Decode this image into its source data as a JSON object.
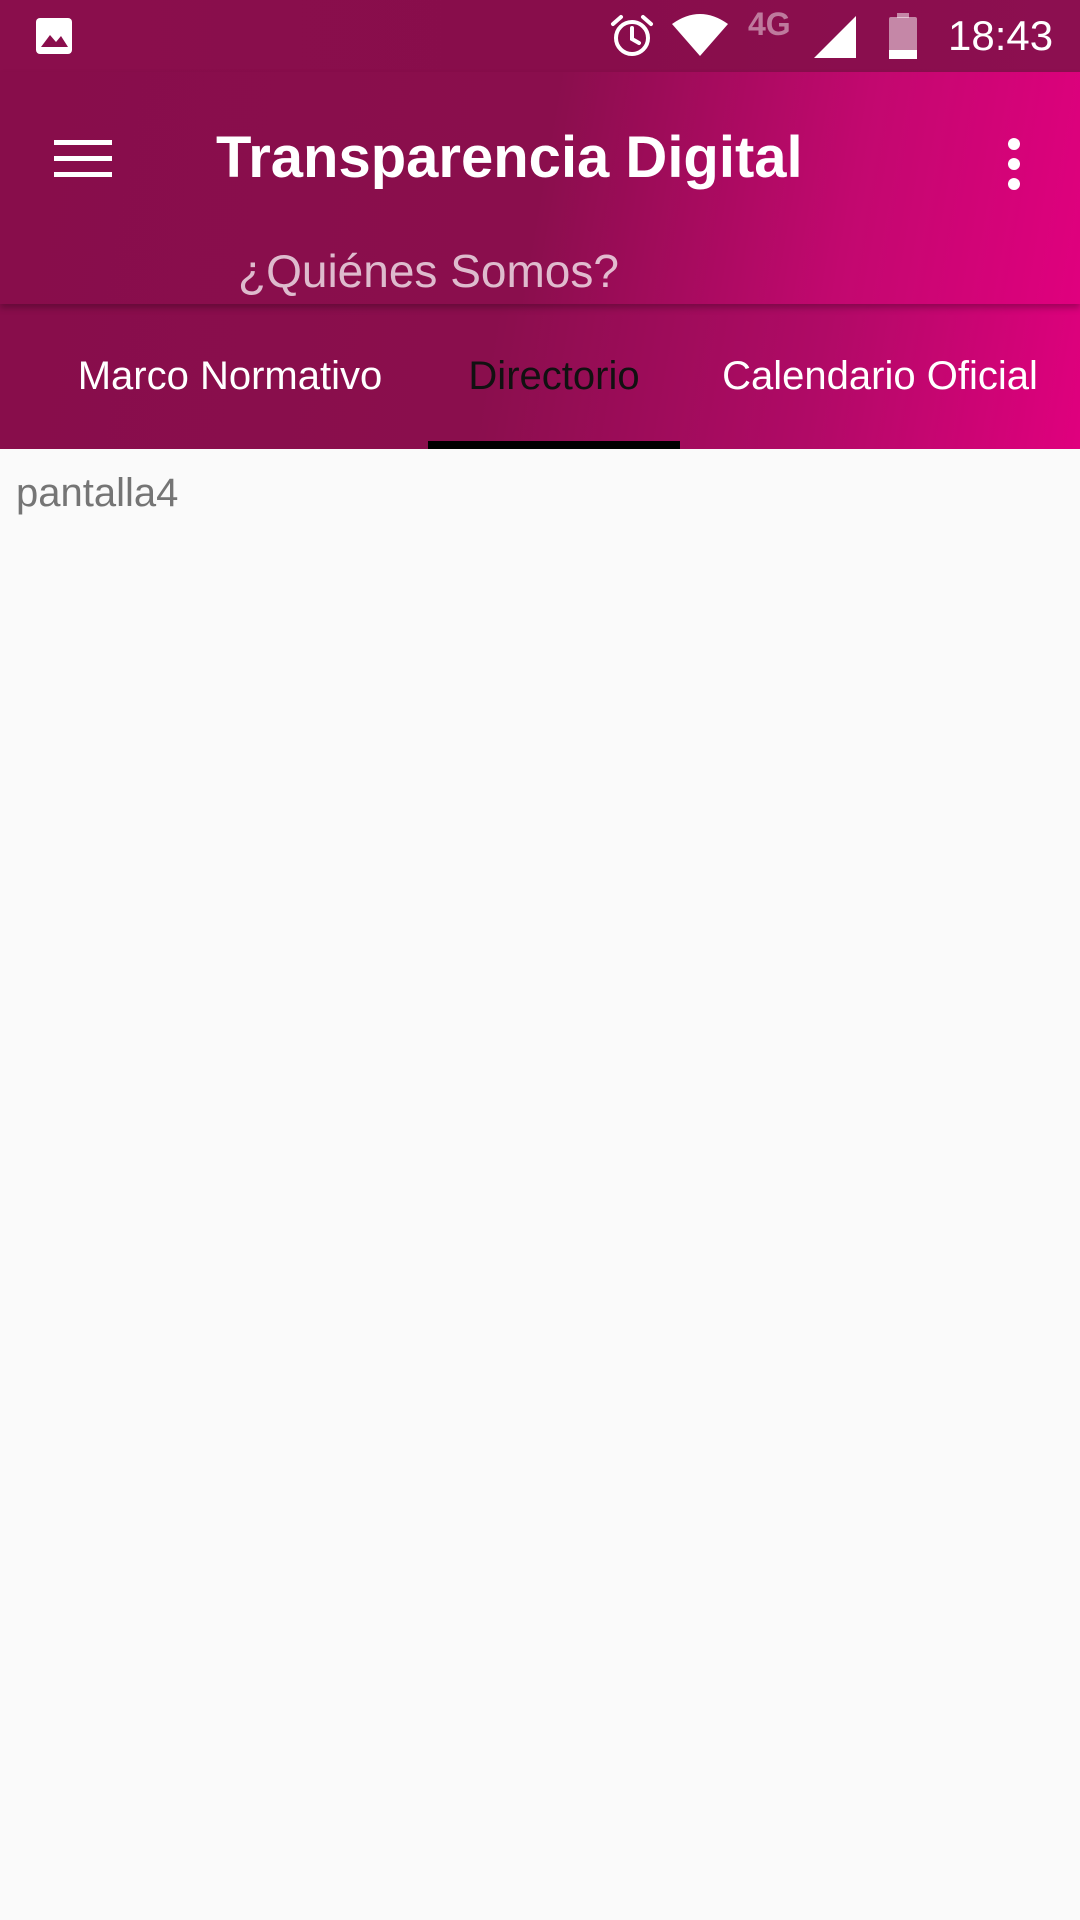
{
  "status_bar": {
    "notification_icon": "image-icon",
    "alarm_icon": "alarm-clock-icon",
    "wifi_icon": "wifi-icon",
    "network_type": "4G",
    "signal_icon": "cellular-signal-icon",
    "battery_icon": "battery-icon",
    "time": "18:43"
  },
  "app_bar": {
    "title": "Transparencia Digital",
    "subtitle": "¿Quiénes Somos?",
    "menu_icon": "hamburger-menu-icon",
    "overflow_icon": "more-vert-icon"
  },
  "tabs": [
    {
      "label": "Marco Normativo",
      "selected": false
    },
    {
      "label": "Directorio",
      "selected": true
    },
    {
      "label": "Calendario Oficial",
      "selected": false
    }
  ],
  "content": {
    "text": "pantalla4"
  },
  "colors": {
    "primary_dark": "#880d4b",
    "accent": "#e0007e",
    "content_background": "#fafafa"
  }
}
